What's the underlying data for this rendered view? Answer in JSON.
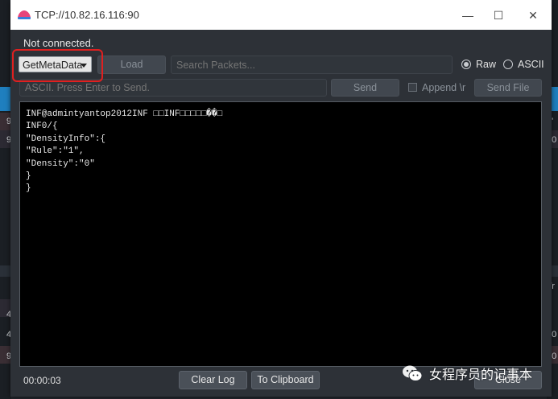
{
  "window": {
    "title": "TCP://10.82.16.116:90",
    "minimize": "—",
    "maximize": "☐",
    "close": "✕"
  },
  "status_text": "Not connected.",
  "toolbar": {
    "mode_select_value": "GetMetaData",
    "load_label": "Load",
    "search_placeholder": "Search Packets...",
    "raw_label": "Raw",
    "ascii_label": "ASCII",
    "raw_selected": true
  },
  "send_row": {
    "input_placeholder": "ASCII. Press Enter to Send.",
    "send_label": "Send",
    "append_label": "Append \\r",
    "send_file_label": "Send File"
  },
  "output": {
    "lines": [
      "INF@admintyantop2012INF □□INF□□□□□��□",
      "INF0/{",
      "\"DensityInfo\":{",
      "\"Rule\":\"1\",",
      "\"Density\":\"0\"",
      "}",
      "}"
    ]
  },
  "footer": {
    "elapsed": "00:00:03",
    "clear_log_label": "Clear Log",
    "clipboard_label": "To Clipboard",
    "close_label": "Close"
  },
  "background": {
    "left_chars": [
      "9",
      "9",
      "4",
      "9",
      "4"
    ],
    "right_chars": [
      "0'",
      "00",
      "Tr",
      "00",
      "00"
    ]
  },
  "watermark": {
    "text": "女程序员的记事本"
  },
  "colors": {
    "highlight": "#e02020",
    "dialog_bg": "#2d3137",
    "output_bg": "#000000"
  }
}
